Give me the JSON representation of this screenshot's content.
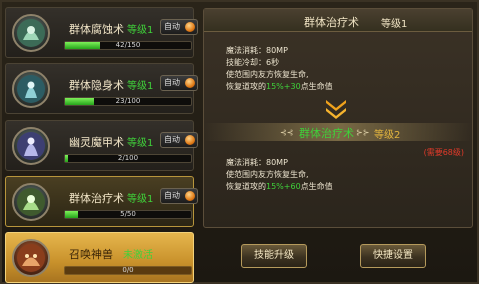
{
  "skills": [
    {
      "name": "群体腐蚀术",
      "level": "等级1",
      "auto": "自动",
      "progress": "42/150",
      "fraction": 0.28
    },
    {
      "name": "群体隐身术",
      "level": "等级1",
      "auto": "自动",
      "progress": "23/100",
      "fraction": 0.23
    },
    {
      "name": "幽灵魔甲术",
      "level": "等级1",
      "auto": "自动",
      "progress": "2/100",
      "fraction": 0.02
    },
    {
      "name": "群体治疗术",
      "level": "等级1",
      "auto": "自动",
      "progress": "5/50",
      "fraction": 0.1
    },
    {
      "name": "召唤神兽",
      "status": "未激活",
      "progress": "0/0",
      "fraction": 0.0
    }
  ],
  "detail": {
    "title": "群体治疗术",
    "level": "等级1",
    "current": {
      "mana": "魔法消耗：80MP",
      "cooldown": "技能冷却：6秒",
      "desc1": "使范围内友方恢复生命,",
      "desc2_a": "恢复道攻的",
      "desc2_b": "15%+30",
      "desc2_c": "点生命值"
    },
    "next_title": "群体治疗术",
    "next_level": "等级2",
    "next_ornament_left": "⊰⊰",
    "next_ornament_right": "⊱⊱",
    "requirement": "(需要68级)",
    "next": {
      "mana": "魔法消耗：80MP",
      "desc1": "使范围内友方恢复生命,",
      "desc2_a": "恢复道攻的",
      "desc2_b": "15%+60",
      "desc2_c": "点生命值"
    }
  },
  "buttons": {
    "upgrade": "技能升级",
    "shortcut": "快捷设置"
  },
  "colors": {
    "accent_green": "#3fd13a",
    "gold": "#e3b53e",
    "warning_red": "#e23a2a"
  }
}
